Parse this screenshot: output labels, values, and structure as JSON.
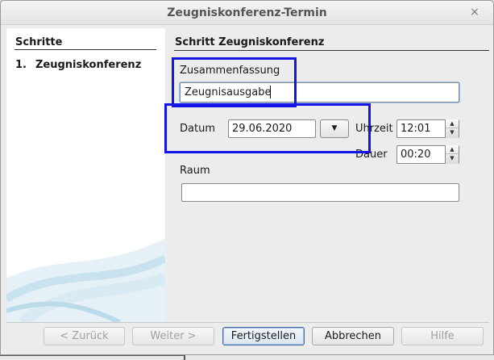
{
  "window": {
    "title": "Zeugniskonferenz-Termin",
    "close_glyph": "×"
  },
  "steps_panel": {
    "heading": "Schritte",
    "items": [
      {
        "number": "1.",
        "label": "Zeugniskonferenz"
      }
    ]
  },
  "content": {
    "heading": "Schritt Zeugniskonferenz",
    "summary": {
      "label": "Zusammenfassung",
      "value": "Zeugnisausgabe"
    },
    "date": {
      "label": "Datum",
      "value": "29.06.2020",
      "dropdown_glyph": "▼"
    },
    "time": {
      "label": "Uhrzeit",
      "value": "12:01"
    },
    "duration": {
      "label": "Dauer",
      "value": "00:20"
    },
    "room": {
      "label": "Raum",
      "value": ""
    },
    "spin_glyphs": {
      "up": "▲",
      "down": "▼"
    }
  },
  "buttons": {
    "back": "< Zurück",
    "next": "Weiter >",
    "finish": "Fertigstellen",
    "cancel": "Abbrechen",
    "help": "Hilfe"
  },
  "colors": {
    "highlight": "#1414e6",
    "window_bg": "#ececec",
    "steps_bg": "#ffffff"
  }
}
